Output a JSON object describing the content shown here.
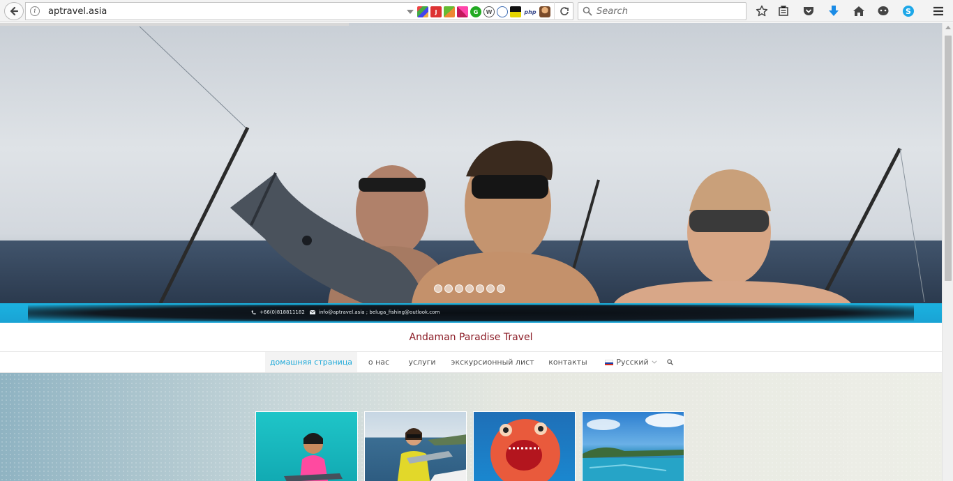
{
  "browser": {
    "url": "aptravel.asia",
    "search_placeholder": "Search",
    "icons": [
      "back-icon",
      "info-icon",
      "dropdown-icon",
      "reload-icon",
      "search-icon",
      "star-icon",
      "reading-list-icon",
      "pocket-icon",
      "download-icon",
      "home-icon",
      "chat-icon",
      "skype-icon",
      "menu-icon"
    ],
    "extension_labels": [
      "",
      "J",
      "",
      "",
      "G",
      "",
      "",
      "",
      "php",
      ""
    ]
  },
  "hero": {
    "slide_count": 7,
    "active_slide": 1
  },
  "info_bar": {
    "phone": "+66(0)818811182",
    "email": "info@aptravel.asia ; beluga_fishing@outlook.com"
  },
  "site": {
    "title": "Andaman Paradise Travel"
  },
  "nav": {
    "items": [
      {
        "label": "домашняя страница",
        "active": true
      },
      {
        "label": "о нас"
      },
      {
        "label": "услуги"
      },
      {
        "label": "экскурсионный лист"
      },
      {
        "label": "контакты"
      }
    ],
    "language": "Русский"
  },
  "colors": {
    "accent": "#1ba8d8",
    "brand": "#8a1a24",
    "info_bar": "#1bb2e0"
  }
}
